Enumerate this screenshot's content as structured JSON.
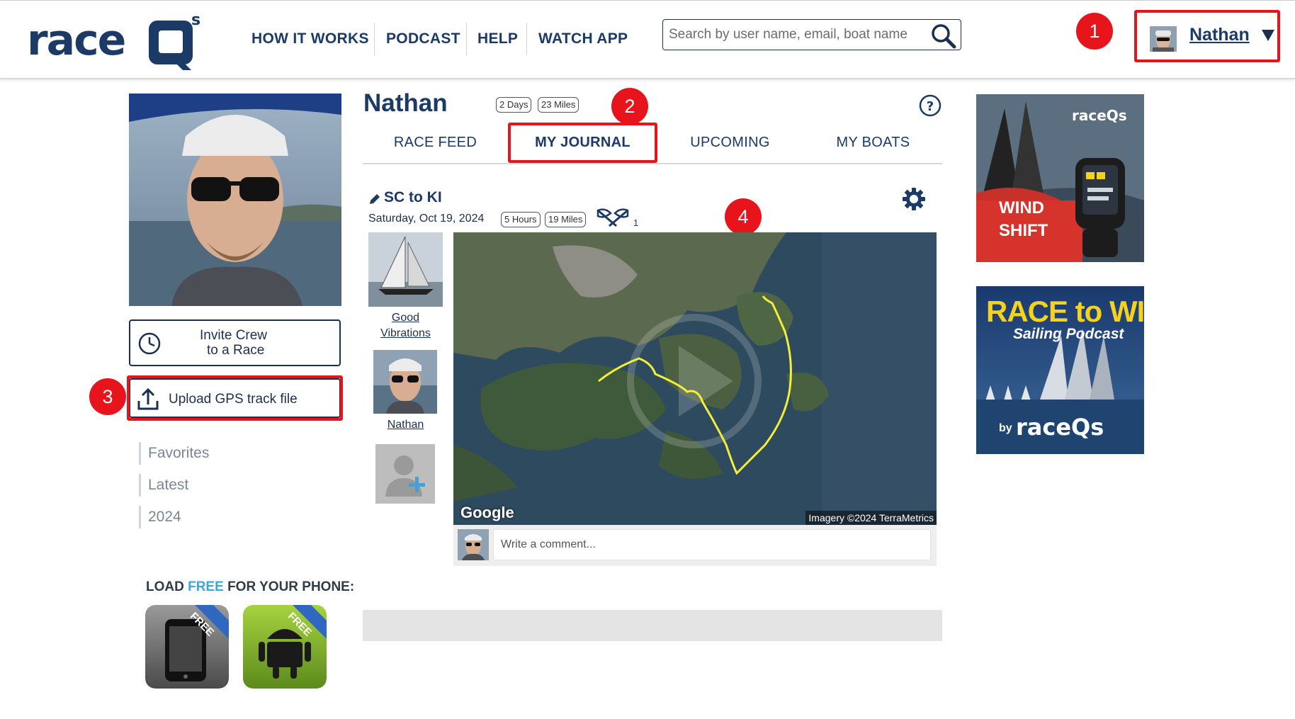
{
  "header": {
    "logo_text": "raceQs",
    "nav": [
      "HOW IT WORKS",
      "PODCAST",
      "HELP",
      "WATCH APP"
    ],
    "search_placeholder": "Search by user name, email, boat name",
    "user_name": "Nathan"
  },
  "callouts": [
    "1",
    "2",
    "3",
    "4"
  ],
  "sidebar": {
    "invite_label_line1": "Invite Crew",
    "invite_label_line2": "to a Race",
    "upload_label": "Upload GPS track file",
    "filters": [
      "Favorites",
      "Latest",
      "2024"
    ],
    "promo_prefix": "LOAD ",
    "promo_free": "FREE",
    "promo_suffix": " FOR YOUR PHONE:",
    "app_badge": "FREE"
  },
  "profile": {
    "name": "Nathan",
    "days": "2 Days",
    "miles": "23 Miles"
  },
  "tabs": [
    "RACE FEED",
    "MY JOURNAL",
    "UPCOMING",
    "MY BOATS"
  ],
  "journal": {
    "title": "SC to KI",
    "date": "Saturday, Oct 19, 2024",
    "hours": "5 Hours",
    "miles": "19 Miles",
    "flag_count": "1",
    "boat_label_line1": "Good",
    "boat_label_line2": "Vibrations",
    "crew_label": "Nathan",
    "map_brand": "Google",
    "map_credit": "Imagery ©2024 TerraMetrics",
    "comment_placeholder": "Write a comment..."
  },
  "ads": {
    "ad1_brand": "raceQs",
    "ad1_line1": "WIND",
    "ad1_line2": "SHIFT",
    "ad2_line1": "RACE to WIN",
    "ad2_line2": "Sailing Podcast",
    "ad2_by": "by",
    "ad2_brand": "raceQs"
  },
  "colors": {
    "navy": "#1b3a66",
    "callout_red": "#e8141c",
    "track_yellow": "#f4ee3a",
    "free_blue": "#39a8d8"
  }
}
